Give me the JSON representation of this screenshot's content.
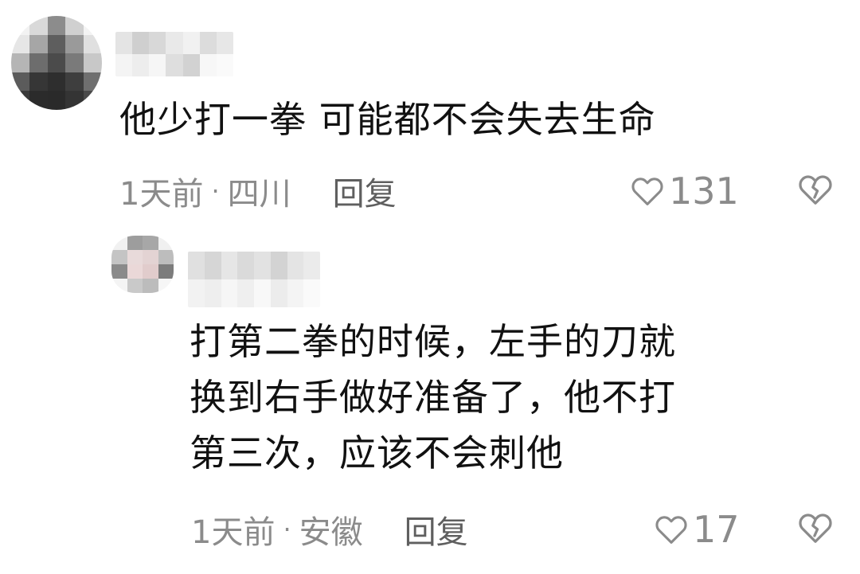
{
  "comments": [
    {
      "text": "他少打一拳 可能都不会失去生命",
      "time": "1天前",
      "separator": "·",
      "location": "四川",
      "reply_label": "回复",
      "likes": "131",
      "icons": {
        "like": "heart-outline-icon",
        "dislike": "broken-heart-icon"
      }
    },
    {
      "text": "打第二拳的时候，左手的刀就\n换到右手做好准备了，他不打\n第三次，应该不会刺他",
      "time": "1天前",
      "separator": "·",
      "location": "安徽",
      "reply_label": "回复",
      "likes": "17",
      "icons": {
        "like": "heart-outline-icon",
        "dislike": "broken-heart-icon"
      }
    }
  ],
  "colors": {
    "text": "#111111",
    "meta": "#8b8b8b",
    "reply": "#5f5f5f",
    "background": "#ffffff"
  }
}
